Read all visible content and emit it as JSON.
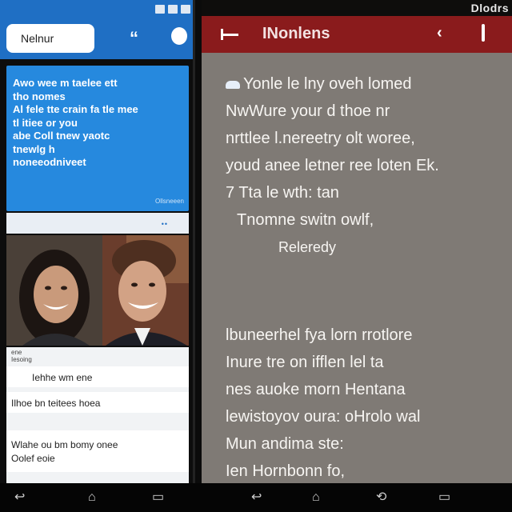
{
  "left_phone": {
    "search_placeholder": "Nelnur",
    "header_icons": {
      "quote": "search-quote-icon",
      "circle": "profile-icon"
    },
    "card_lines": [
      "Awo wee m taelee ett",
      "tho nomes",
      "Al fele tte crain fa tle mee",
      "tl itiee or you",
      "abe Coll tnew yaotc",
      "tnewlg h",
      "noneeodniveet"
    ],
    "card_meta": "Ollsneeen",
    "strip_dots": "••",
    "list_labels": [
      "ene",
      "Iesoing"
    ],
    "list_rows": [
      "Iehhe wm ene",
      "Ilhoe bn teitees hoea"
    ],
    "list_tall_lines": [
      "Wlahe ou bm bomy onee",
      "Oolef eoie"
    ]
  },
  "right_phone": {
    "top_text": "Dlodrs",
    "title": "INonlens",
    "paragraph1": [
      "Yonle le lny oveh lomed",
      "NwWure your d thoe nr",
      "nrttlee l.nereetry olt woree,",
      "youd anee letner ree loten Ek.",
      "7 Tta le wth: tan",
      "Tnomne switn owlf,",
      "Releredy"
    ],
    "paragraph2": [
      "lbuneerhel fya lorn rrotlore",
      "Inure tre on ifflen lel ta",
      "nes auoke morn Hentana",
      "lewistoyov oura: oHrolo wal",
      "Mun andima ste:",
      "Ien Hornbonn fo,"
    ],
    "header_icons": {
      "chevron": "back-chevron-icon",
      "menu": "overflow-menu-icon"
    }
  },
  "navbar": {
    "icons": [
      "back-icon",
      "home-icon",
      "recents-icon",
      "back-icon",
      "home-icon",
      "rotate-icon",
      "recents-icon"
    ]
  },
  "colors": {
    "left_accent": "#1f6fc4",
    "left_card": "#2689de",
    "right_header": "#8a1b1c",
    "right_body": "#7f7a75"
  }
}
